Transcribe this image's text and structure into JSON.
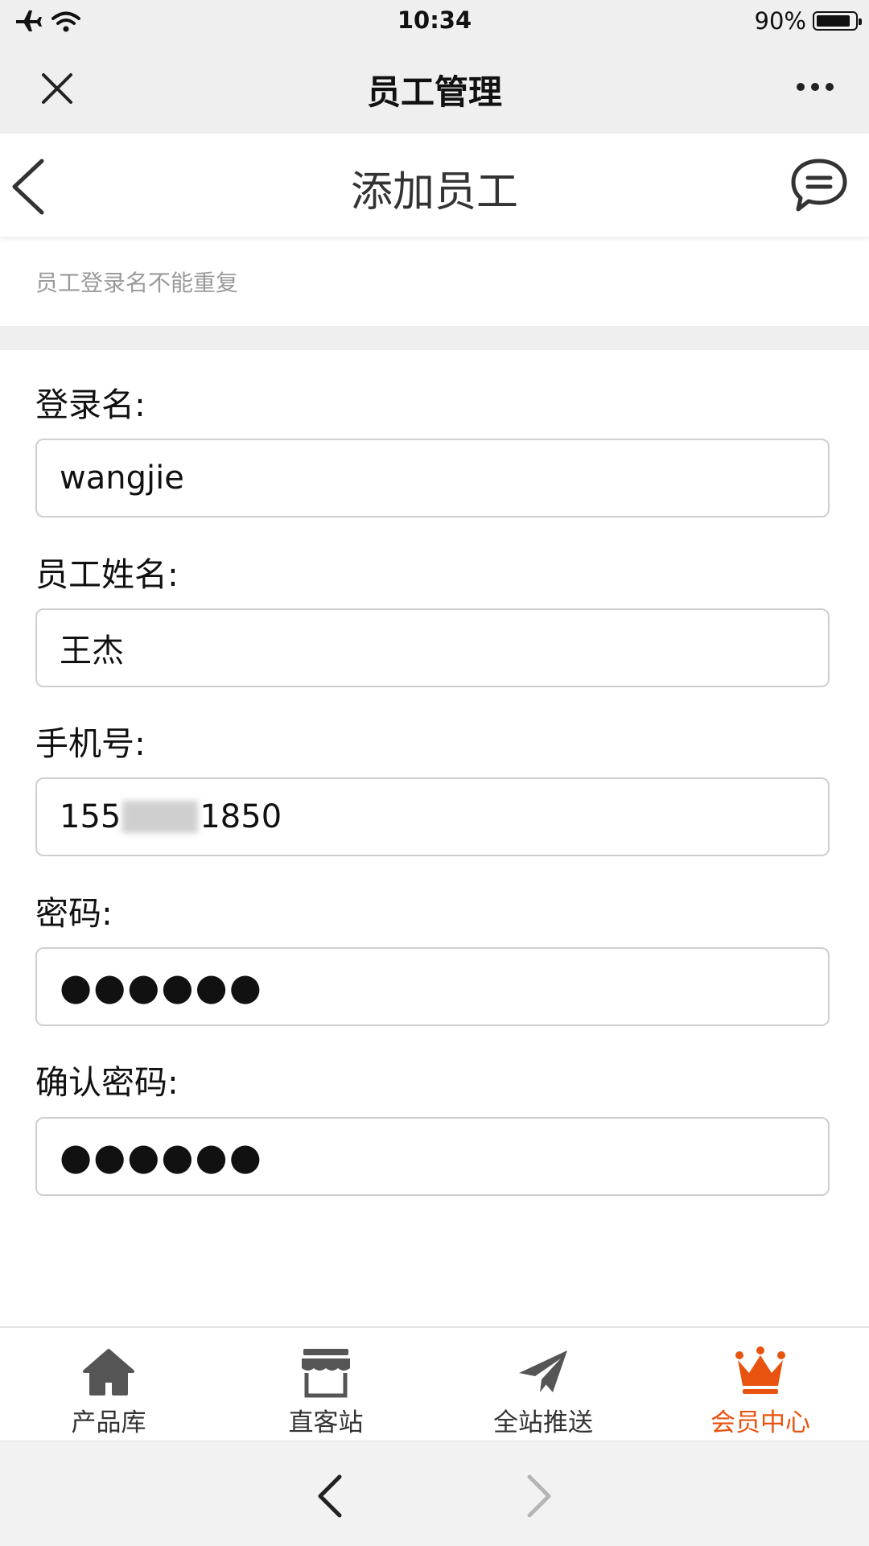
{
  "status_bar": {
    "time": "10:34",
    "battery_percent": "90%",
    "battery_level": 0.9,
    "icons": [
      "airplane-icon",
      "wifi-icon",
      "battery-icon"
    ]
  },
  "wechat_bar": {
    "title": "员工管理",
    "icons": [
      "close-icon",
      "more-icon"
    ]
  },
  "page_header": {
    "title": "添加员工",
    "icons": [
      "back-chevron-icon",
      "chat-bubble-icon"
    ]
  },
  "hint": "员工登录名不能重复",
  "form": {
    "login_name": {
      "label": "登录名:",
      "value": "wangjie"
    },
    "employee_name": {
      "label": "员工姓名:",
      "value": "王杰"
    },
    "phone": {
      "label": "手机号:",
      "value_prefix": "155",
      "value_suffix": "1850"
    },
    "password": {
      "label": "密码:",
      "value": "●●●●●●"
    },
    "confirm_password": {
      "label": "确认密码:",
      "value": "●●●●●●"
    }
  },
  "tabbar": {
    "items": [
      {
        "label": "产品库",
        "icon": "home-icon",
        "active": false
      },
      {
        "label": "直客站",
        "icon": "store-icon",
        "active": false
      },
      {
        "label": "全站推送",
        "icon": "paper-plane-icon",
        "active": false
      },
      {
        "label": "会员中心",
        "icon": "crown-icon",
        "active": true
      }
    ],
    "active_color": "#e8540f",
    "inactive_color": "#555555"
  },
  "browser_nav": {
    "icons": [
      "nav-back-icon",
      "nav-forward-icon"
    ]
  }
}
